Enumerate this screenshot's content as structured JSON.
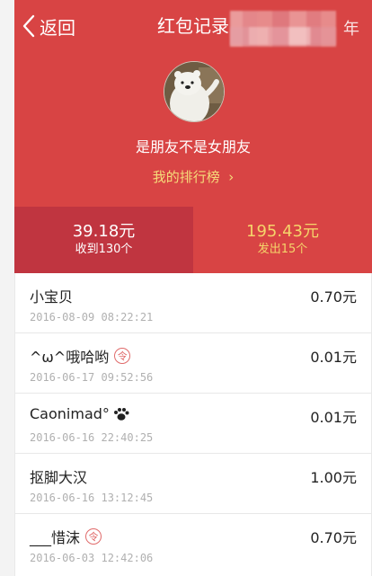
{
  "header": {
    "back_label": "返回",
    "title": "红包记录",
    "year_suffix": "年",
    "nickname": "是朋友不是女朋友",
    "rank_label": "我的排行榜"
  },
  "stats": {
    "received": {
      "amount": "39.18元",
      "label": "收到130个"
    },
    "sent": {
      "amount": "195.43元",
      "label": "发出15个"
    }
  },
  "records": [
    {
      "name": "小宝贝",
      "time": "2016-08-09 08:22:21",
      "amount": "0.70元",
      "badge": ""
    },
    {
      "name": "^ω^哦哈哟",
      "time": "2016-06-17 09:52:56",
      "amount": "0.01元",
      "badge": "令"
    },
    {
      "name": "Caonimad°",
      "time": "2016-06-16 22:40:25",
      "amount": "0.01元",
      "badge": ""
    },
    {
      "name": "抠脚大汉",
      "time": "2016-06-16 13:12:45",
      "amount": "1.00元",
      "badge": ""
    },
    {
      "name": "___惜沫",
      "time": "2016-06-03 12:42:06",
      "amount": "0.70元",
      "badge": "令"
    }
  ],
  "colors": {
    "header_red": "#d84444",
    "received_bg": "#c03540",
    "gold": "#f5d46a"
  }
}
